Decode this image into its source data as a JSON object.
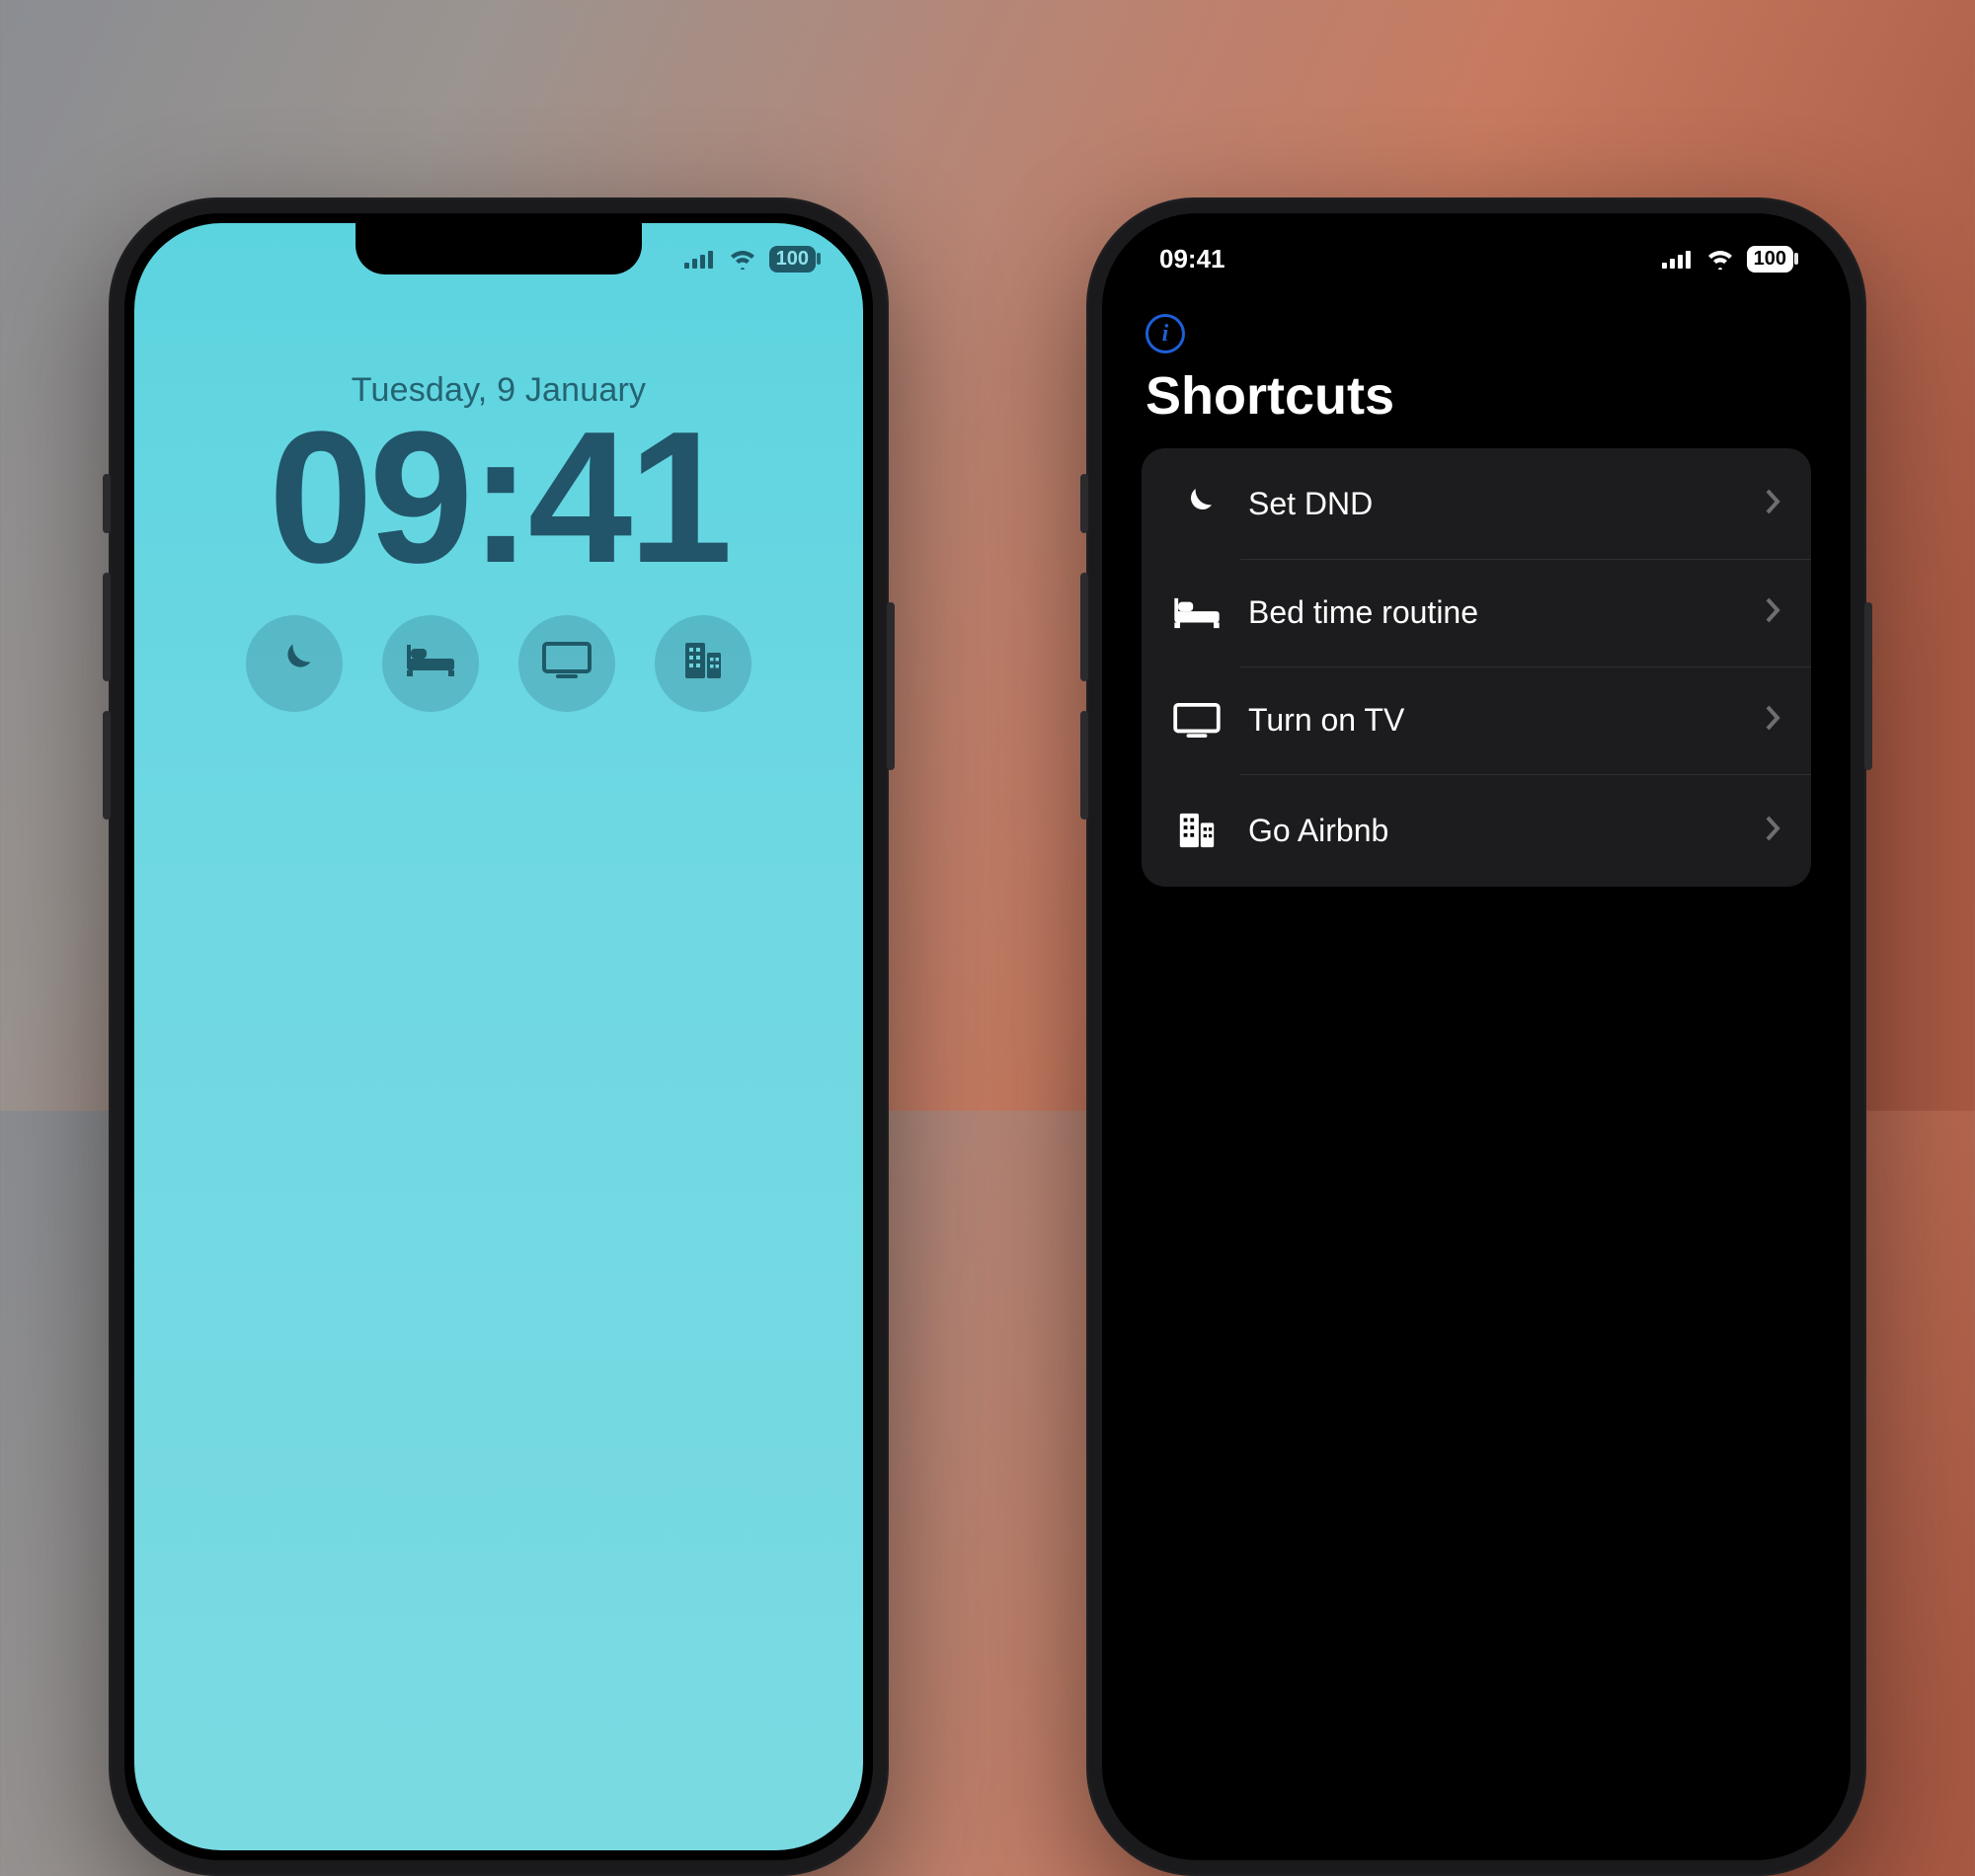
{
  "status": {
    "time": "09:41",
    "battery": "100"
  },
  "lockscreen": {
    "date": "Tuesday, 9 January",
    "time": "09:41",
    "widgets": [
      {
        "icon": "moon-icon"
      },
      {
        "icon": "bed-icon"
      },
      {
        "icon": "tv-icon"
      },
      {
        "icon": "building-icon"
      }
    ]
  },
  "shortcuts": {
    "title": "Shortcuts",
    "items": [
      {
        "icon": "moon-icon",
        "label": "Set DND"
      },
      {
        "icon": "bed-icon",
        "label": "Bed time routine"
      },
      {
        "icon": "tv-icon",
        "label": "Turn on TV"
      },
      {
        "icon": "building-icon",
        "label": "Go Airbnb"
      }
    ]
  }
}
